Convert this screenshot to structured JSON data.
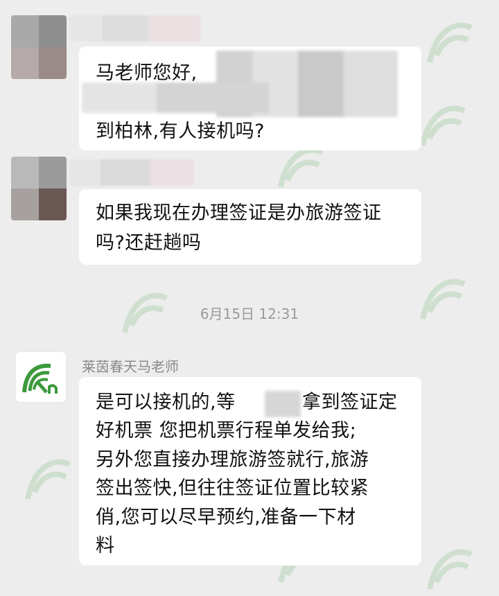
{
  "messages": [
    {
      "sender": "",
      "lines": [
        "马老师您好,",
        "",
        "到柏林,有人接机吗?"
      ]
    },
    {
      "sender": "",
      "lines": [
        "如果我现在办理签证是办旅游签证",
        "吗?还赶趟吗"
      ]
    },
    {
      "sender": "莱茵春天马老师",
      "lines": [
        "是可以接机的,等",
        "好机票 您把机票行程单发给我;",
        "另外您直接办理旅游签就行,旅游",
        "签出签快,但往往签证位置比较紧",
        "俏,您可以尽早预约,准备一下材",
        "料"
      ],
      "line1_tail": "拿到签证定"
    }
  ],
  "timestamp": "6月15日 12:31",
  "watermark_icon": "rn-logo-watermark",
  "colors": {
    "background": "#ededed",
    "bubble": "#ffffff",
    "logo_green": "#3c9a3c"
  }
}
